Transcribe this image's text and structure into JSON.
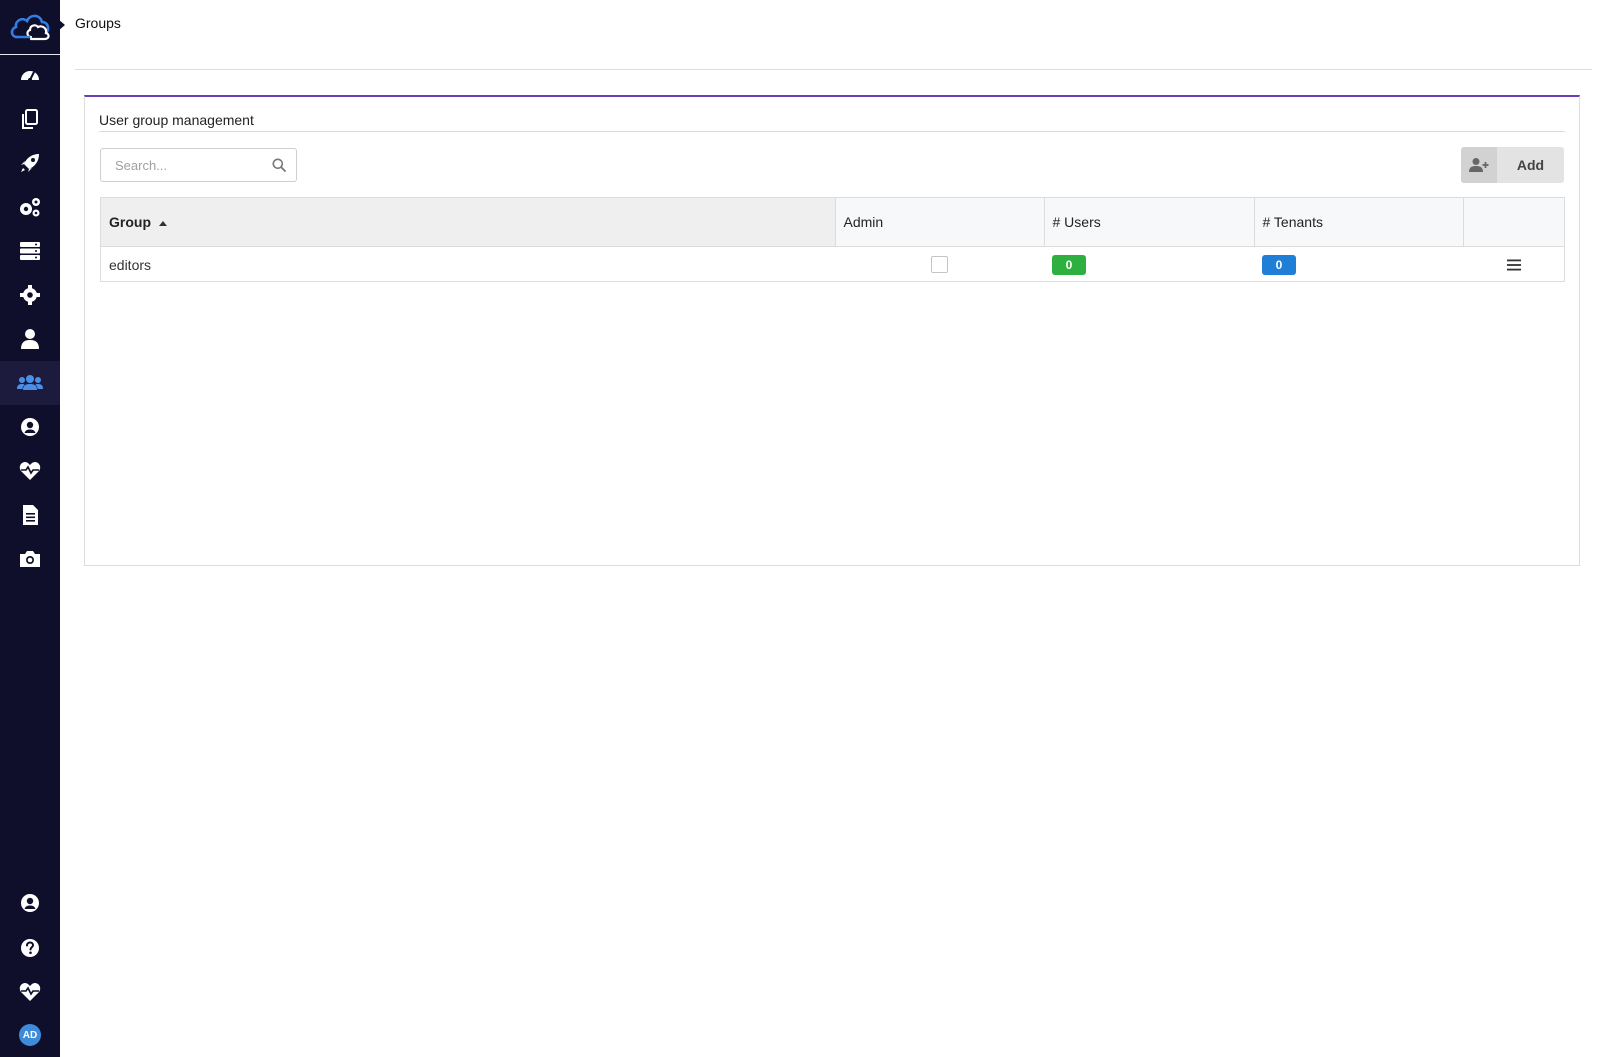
{
  "header": {
    "page_title": "Groups"
  },
  "sidebar": {
    "logo": "cloud-logo-icon",
    "top_items": [
      {
        "icon": "speedometer-icon",
        "active": false
      },
      {
        "icon": "copy-icon",
        "active": false
      },
      {
        "icon": "rocket-icon",
        "active": false
      },
      {
        "icon": "cogs-icon",
        "active": false
      },
      {
        "icon": "server-icon",
        "active": false
      },
      {
        "icon": "gear-icon",
        "active": false
      },
      {
        "icon": "user-icon",
        "active": false
      },
      {
        "icon": "users-icon",
        "active": true
      },
      {
        "icon": "user-circle-icon",
        "active": false
      },
      {
        "icon": "heartbeat-icon",
        "active": false
      },
      {
        "icon": "document-icon",
        "active": false
      },
      {
        "icon": "camera-icon",
        "active": false
      }
    ],
    "bottom_items": [
      {
        "icon": "user-circle-icon"
      },
      {
        "icon": "question-icon"
      },
      {
        "icon": "heartbeat-icon"
      }
    ],
    "avatar_initials": "AD",
    "accent": "#3d8bd9"
  },
  "panel": {
    "title": "User group management",
    "accent_color": "#6a3db8",
    "search": {
      "placeholder": "Search...",
      "value": ""
    },
    "add_button": {
      "label": "Add",
      "icon": "user-plus-icon"
    },
    "table": {
      "columns": [
        {
          "label": "Group",
          "sorted": "asc"
        },
        {
          "label": "Admin"
        },
        {
          "label": "# Users"
        },
        {
          "label": "# Tenants"
        },
        {
          "label": ""
        }
      ],
      "rows": [
        {
          "group": "editors",
          "admin": false,
          "users": "0",
          "tenants": "0",
          "actions_icon": "hamburger-menu-icon"
        }
      ]
    },
    "badge_colors": {
      "users": "#2db040",
      "tenants": "#1f7fd6"
    }
  }
}
